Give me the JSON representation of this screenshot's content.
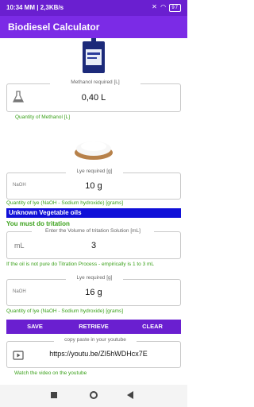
{
  "status": {
    "time": "10:34 MM | 2,3KB/s",
    "battery": "97"
  },
  "app": {
    "title": "Biodiesel Calculator"
  },
  "methanol": {
    "legend": "Methanol required [L]",
    "value": "0,40 L",
    "helper": "Quantity of Methanol [L]"
  },
  "lye1": {
    "legend": "Lye required [g]",
    "icon_text": "NaOH",
    "value": "10 g",
    "helper": "Quantity of lye (NaOH - Sodium hydroxide) [grams]"
  },
  "oil": {
    "banner": "Unknown Vegetable oils",
    "warning": "You must do tritation"
  },
  "tritation": {
    "legend": "Enter the Volume of tritation Solution [mL]",
    "icon_text": "mL",
    "value": "3",
    "helper": "If the oil is not pure do Titration Process - empirically is 1 to 3 mL"
  },
  "lye2": {
    "legend": "Lye required [g]",
    "icon_text": "NaOH",
    "value": "16 g",
    "helper": "Quantity of lye (NaOH - Sodium hydroxide) [grams]"
  },
  "buttons": {
    "save": "SAVE",
    "retrieve": "RETRIEVE",
    "clear": "CLEAR"
  },
  "youtube": {
    "legend": "copy paste in your youtube",
    "value": "https://youtu.be/ZI5hWDHcx7E",
    "helper": "Watch the video on the youtube"
  },
  "colors": {
    "primary": "#7b2be6",
    "status": "#6a1fd0",
    "banner": "#1010d8",
    "helper": "#3aa11a"
  }
}
